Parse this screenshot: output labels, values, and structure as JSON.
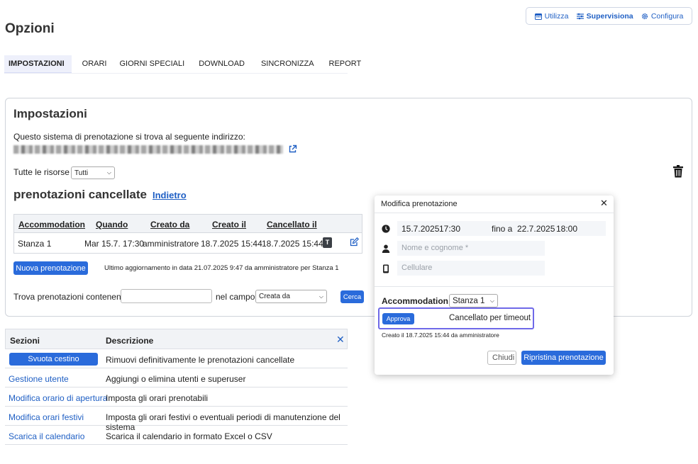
{
  "topnav": {
    "use_label": "Utilizza",
    "supervise_label": "Supervisiona",
    "configure_label": "Configura"
  },
  "page_title": "Opzioni",
  "tabs": [
    {
      "label": "IMPOSTAZIONI",
      "active": true
    },
    {
      "label": "ORARI"
    },
    {
      "label": "GIORNI SPECIALI"
    },
    {
      "label": "DOWNLOAD"
    },
    {
      "label": "SINCRONIZZA"
    },
    {
      "label": "REPORT"
    }
  ],
  "settings": {
    "title": "Impostazioni",
    "address_text": "Questo sistema di prenotazione si trova al seguente indirizzo:",
    "resources_label": "Tutte le risorse",
    "resources_selected": "Tutti",
    "cancelled_title": "prenotazioni cancellate",
    "back_link": "Indietro",
    "columns": [
      "Accommodation",
      "Quando",
      "Creato da",
      "Creato il",
      "Cancellato il"
    ],
    "row": {
      "accommodation": "Stanza 1",
      "quando": "Mar 15.7. 17:30",
      "creato_da": "amministratore",
      "creato_il": "18.7.2025 15:44",
      "cancellato_il": "18.7.2025 15:44",
      "badge": "T"
    },
    "new_booking_label": "Nuova prenotazione",
    "last_update": "Ultimo aggiornamento in data 21.07.2025 9:47 da amministratore per Stanza 1",
    "search_label": "Trova prenotazioni contenenti",
    "search_value": "",
    "field_label": "nel campo",
    "field_selected": "Creata da",
    "search_button": "Cerca"
  },
  "sections": {
    "col_section": "Sezioni",
    "col_description": "Descrizione",
    "rows": [
      {
        "name": "Svuota cestino",
        "description": "Rimuovi definitivamente le prenotazioni cancellate",
        "is_button": true
      },
      {
        "name": "Gestione utente",
        "description": "Aggiungi o elimina utenti e superuser"
      },
      {
        "name": "Modifica orario di apertura",
        "description": "Imposta gli orari prenotabili"
      },
      {
        "name": "Modifica orari festivi",
        "description": "Imposta gli orari festivi o eventuali periodi di manutenzione del sistema"
      },
      {
        "name": "Scarica il calendario",
        "description": "Scarica il calendario in formato Excel o CSV"
      }
    ]
  },
  "modal": {
    "title": "Modifica prenotazione",
    "start_date": "15.7.2025",
    "start_time": "17:30",
    "until_label": "fino a",
    "end_date": "22.7.2025",
    "end_time": "18:00",
    "name_placeholder": "Nome e cognome *",
    "phone_placeholder": "Cellulare",
    "accommodation_label": "Accommodation",
    "accommodation_selected": "Stanza 1",
    "approve_label": "Approva",
    "status_text": "Cancellato per timeout",
    "created_text": "Creato il 18.7.2025 15:44 da amministratore",
    "close_label": "Chiudi",
    "restore_label": "Ripristina prenotazione"
  },
  "colors": {
    "accent": "#2a6bdb",
    "highlight": "#6f69e8"
  }
}
